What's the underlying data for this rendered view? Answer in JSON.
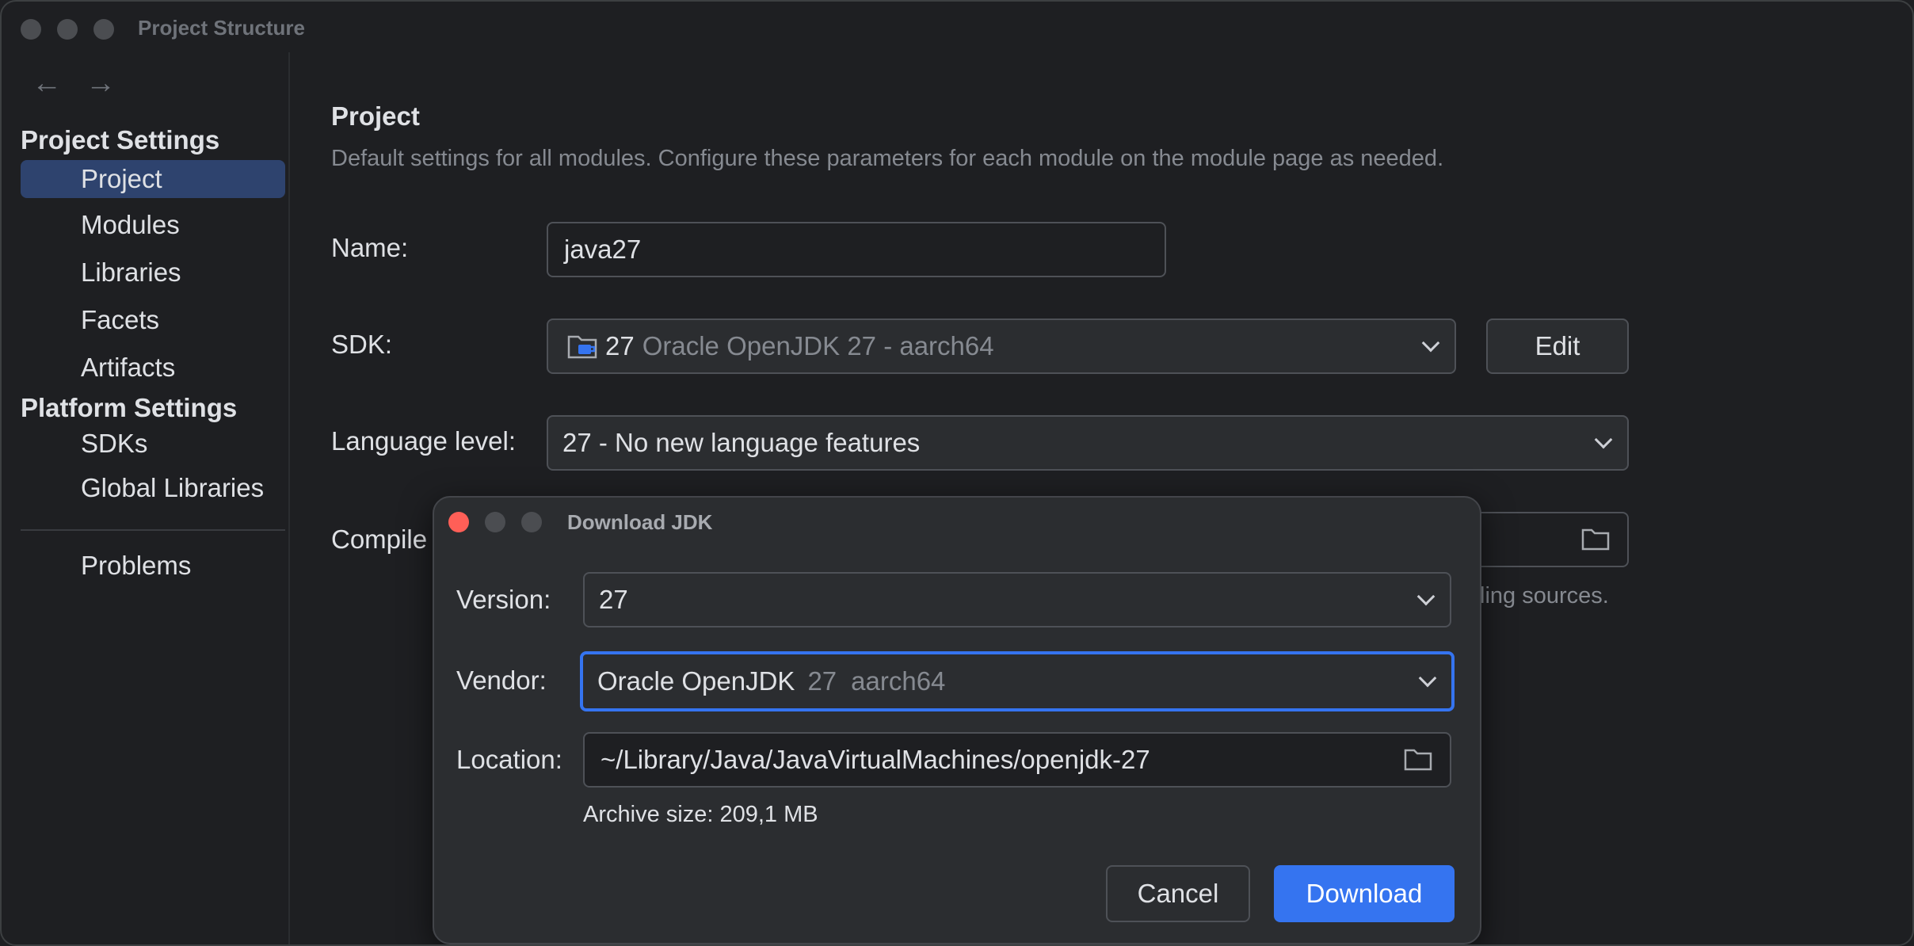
{
  "window": {
    "title": "Project Structure"
  },
  "sidebar": {
    "project_settings_title": "Project Settings",
    "project_settings_items": [
      "Project",
      "Modules",
      "Libraries",
      "Facets",
      "Artifacts"
    ],
    "platform_settings_title": "Platform Settings",
    "platform_settings_items": [
      "SDKs",
      "Global Libraries"
    ],
    "problems": "Problems",
    "selected": "Project"
  },
  "main": {
    "title": "Project",
    "description": "Default settings for all modules. Configure these parameters for each module on the module page as needed.",
    "name_label": "Name:",
    "name_value": "java27",
    "sdk_label": "SDK:",
    "sdk_version": "27",
    "sdk_name": "Oracle OpenJDK 27 - aarch64",
    "edit_button": "Edit",
    "language_level_label": "Language level:",
    "language_level_value": "27 - No new language features",
    "compiler_label_partial": "Compile",
    "compiler_hint_partial": "ling sources."
  },
  "dialog": {
    "title": "Download JDK",
    "version_label": "Version:",
    "version_value": "27",
    "vendor_label": "Vendor:",
    "vendor_name": "Oracle OpenJDK",
    "vendor_version": "27",
    "vendor_arch": "aarch64",
    "location_label": "Location:",
    "location_value": "~/Library/Java/JavaVirtualMachines/openjdk-27",
    "archive_size": "Archive size: 209,1 MB",
    "cancel_button": "Cancel",
    "download_button": "Download"
  },
  "colors": {
    "accent": "#3574f0",
    "selection": "#2e436e",
    "close": "#ff5f57"
  },
  "icons": [
    "back-arrow-icon",
    "forward-arrow-icon",
    "chevron-down-icon",
    "folder-icon",
    "jdk-folder-icon"
  ]
}
